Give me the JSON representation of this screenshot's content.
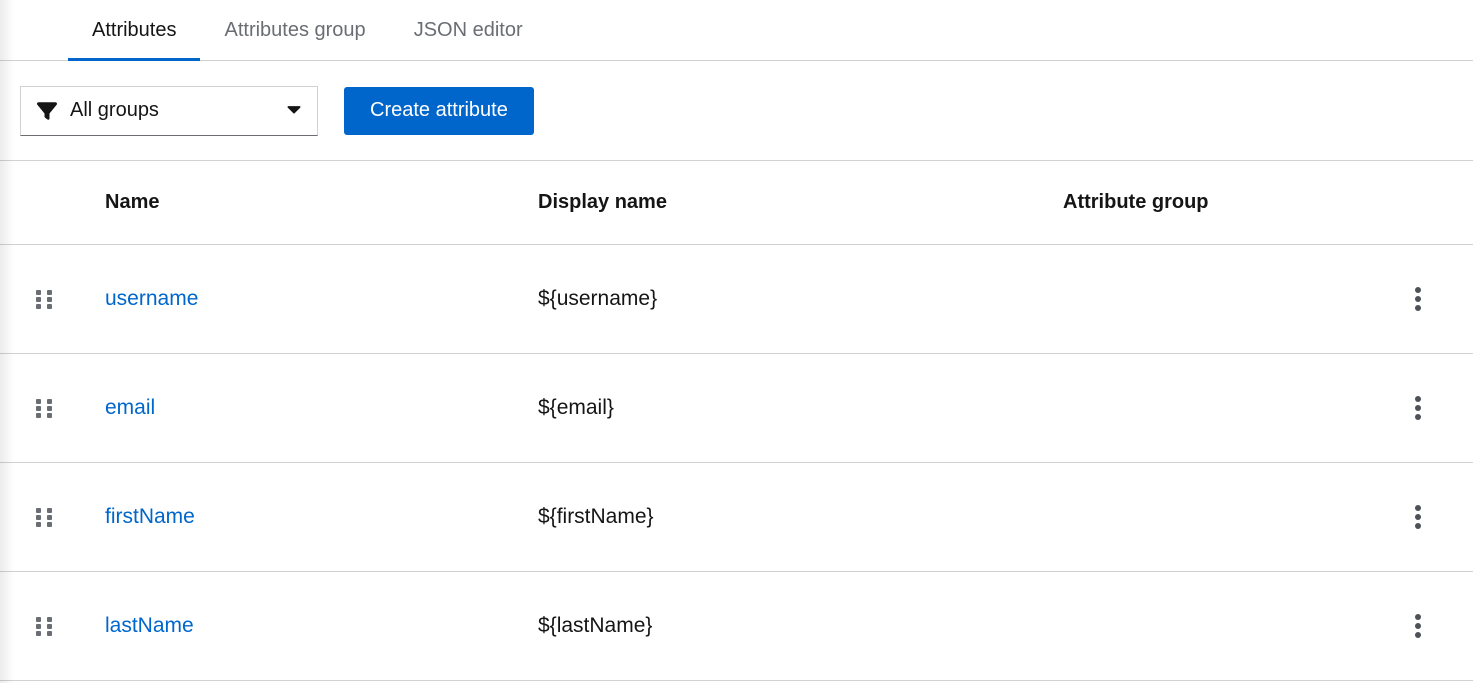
{
  "tabs": [
    {
      "label": "Attributes",
      "active": true
    },
    {
      "label": "Attributes group",
      "active": false
    },
    {
      "label": "JSON editor",
      "active": false
    }
  ],
  "toolbar": {
    "group_filter": {
      "value": "All groups",
      "icon": "filter-icon",
      "caret": "caret-down-icon"
    },
    "create_button_label": "Create attribute"
  },
  "table": {
    "columns": {
      "name": "Name",
      "display_name": "Display name",
      "attribute_group": "Attribute group"
    },
    "row_icons": {
      "drag": "drag-handle-icon",
      "menu": "kebab-menu-icon"
    },
    "rows": [
      {
        "name": "username",
        "display_name": "${username}",
        "attribute_group": ""
      },
      {
        "name": "email",
        "display_name": "${email}",
        "attribute_group": ""
      },
      {
        "name": "firstName",
        "display_name": "${firstName}",
        "attribute_group": ""
      },
      {
        "name": "lastName",
        "display_name": "${lastName}",
        "attribute_group": ""
      }
    ]
  },
  "colors": {
    "primary": "#0066cc",
    "link": "#0066cc",
    "text": "#151515",
    "muted_text": "#6a6e73",
    "border": "#d2d2d2",
    "active_tab_underline": "#0066cc"
  }
}
